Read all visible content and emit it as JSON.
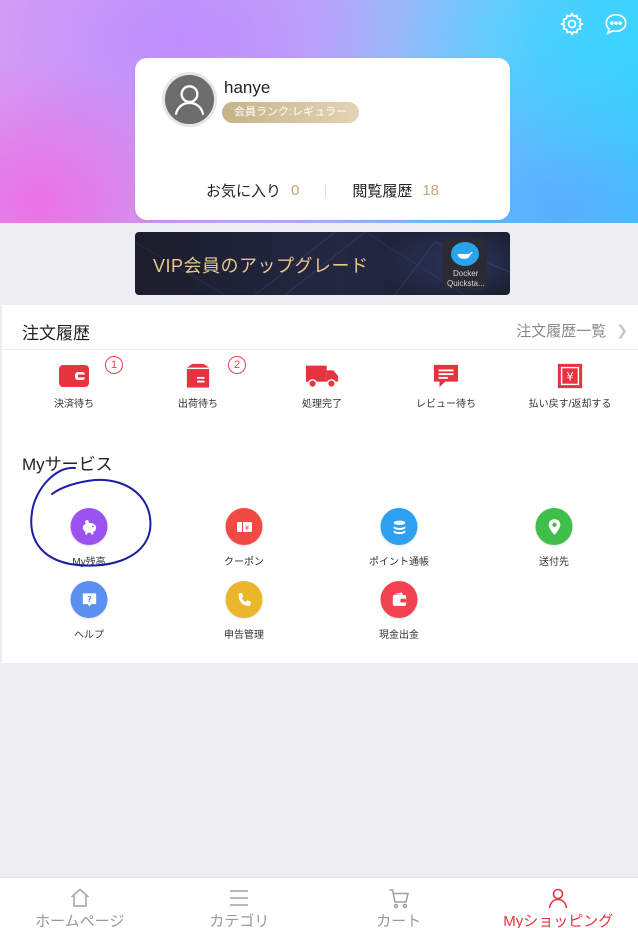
{
  "header": {
    "settings_icon": "gear-icon",
    "message_icon": "chat-bubble-icon"
  },
  "profile": {
    "username": "hanye",
    "rank_badge": "会員ランク:レギュラー",
    "favorites_label": "お気に入り",
    "favorites_count": "0",
    "history_label": "閲覧履歴",
    "history_count": "18"
  },
  "vip_banner": {
    "text": "VIP会員のアップグレード",
    "thumb_line1": "Docker",
    "thumb_line2": "Quicksta..."
  },
  "orders": {
    "title": "注文履歴",
    "view_all": "注文履歴一覧",
    "items": [
      {
        "label": "決済待ち",
        "badge": "1",
        "icon": "wallet-icon"
      },
      {
        "label": "出荷待ち",
        "badge": "2",
        "icon": "box-icon"
      },
      {
        "label": "処理完了",
        "icon": "truck-icon"
      },
      {
        "label": "レビュー待ち",
        "icon": "comment-icon"
      },
      {
        "label": "払い戻す/返却する",
        "icon": "refund-icon"
      }
    ]
  },
  "services": {
    "title": "Myサービス",
    "items": [
      {
        "label": "My残高",
        "icon": "piggy-bank-icon",
        "color": "#9b52f0"
      },
      {
        "label": "クーポン",
        "icon": "coupon-icon",
        "color": "#f04a45"
      },
      {
        "label": "ポイント通帳",
        "icon": "coins-icon",
        "color": "#2f9ff0"
      },
      {
        "label": "送付先",
        "icon": "location-pin-icon",
        "color": "#3fbf4a"
      },
      {
        "label": "ヘルプ",
        "icon": "help-icon",
        "color": "#5b8ff0"
      },
      {
        "label": "申告管理",
        "icon": "phone-icon",
        "color": "#eab62a"
      },
      {
        "label": "現金出金",
        "icon": "wallet-icon",
        "color": "#f0434f"
      }
    ]
  },
  "tabbar": {
    "items": [
      {
        "label": "ホームページ",
        "icon": "home-icon"
      },
      {
        "label": "カテゴリ",
        "icon": "list-icon"
      },
      {
        "label": "カート",
        "icon": "cart-icon"
      },
      {
        "label": "Myショッピング",
        "icon": "user-icon",
        "active": true
      }
    ]
  },
  "colors": {
    "accent_red": "#e5343f",
    "gold": "#c0a67a",
    "annotation_ink": "#1c1ca8"
  }
}
